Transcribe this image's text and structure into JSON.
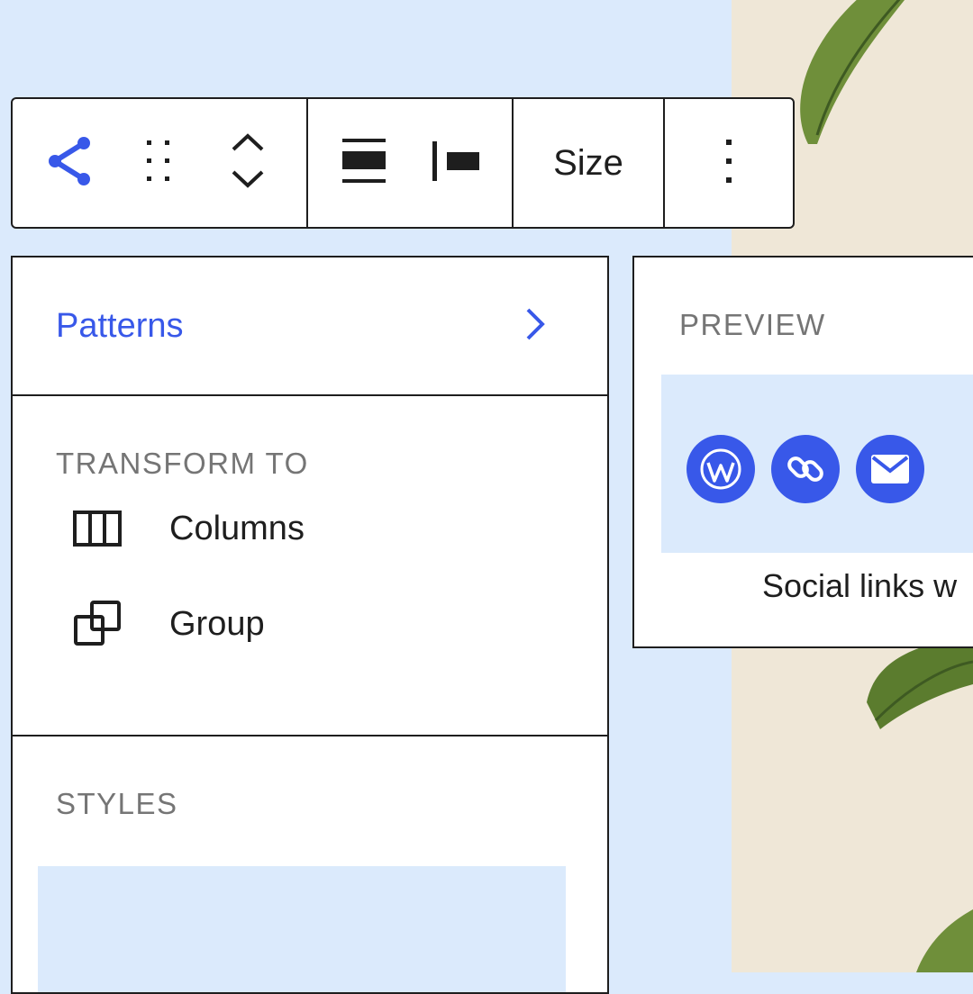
{
  "toolbar": {
    "size_label": "Size"
  },
  "panel": {
    "patterns_label": "Patterns",
    "transform_title": "TRANSFORM TO",
    "transform_items": [
      {
        "label": "Columns",
        "icon": "columns-icon"
      },
      {
        "label": "Group",
        "icon": "group-icon"
      }
    ],
    "styles_title": "STYLES"
  },
  "preview": {
    "title": "PREVIEW",
    "icons": [
      "wordpress-icon",
      "link-icon",
      "mail-icon"
    ],
    "caption": "Social links w"
  },
  "colors": {
    "accent": "#3858e9",
    "background": "#dbeafc",
    "border": "#1e1e1e",
    "muted_text": "#757575"
  }
}
